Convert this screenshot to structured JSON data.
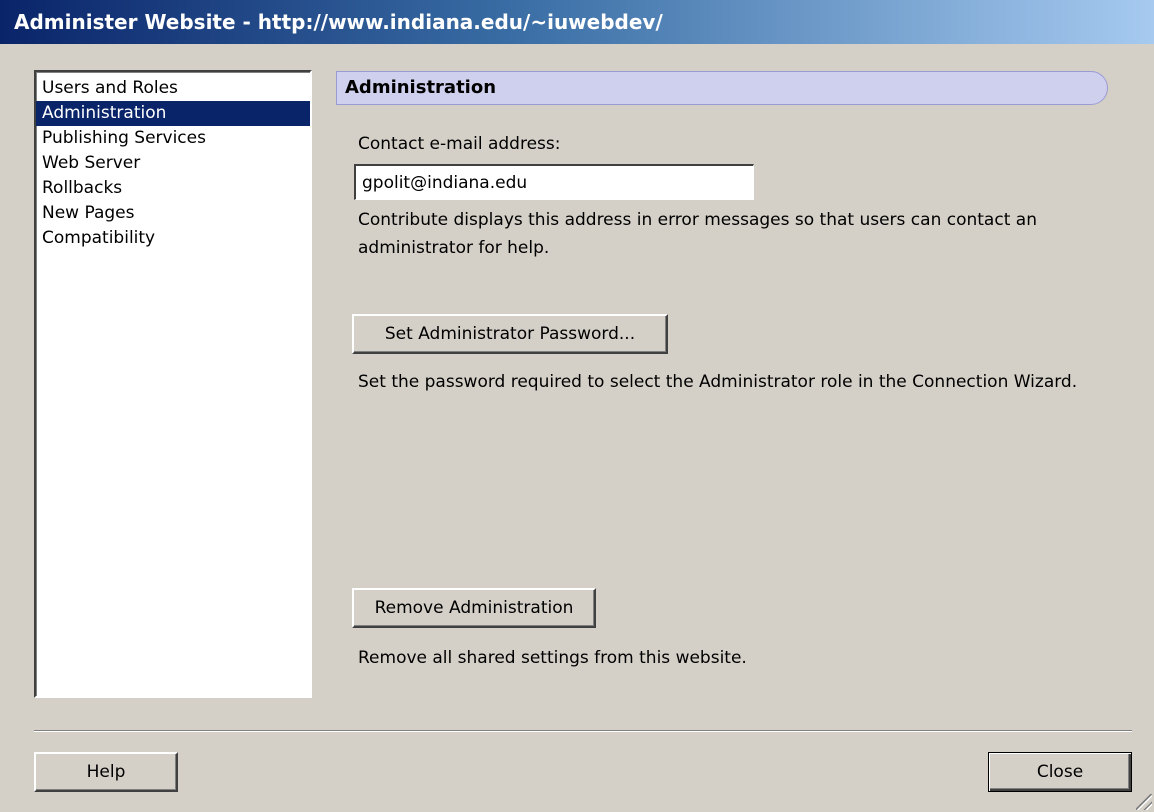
{
  "window": {
    "title": "Administer Website - http://www.indiana.edu/~iuwebdev/"
  },
  "sidebar": {
    "items": [
      {
        "label": "Users and Roles",
        "selected": false
      },
      {
        "label": "Administration",
        "selected": true
      },
      {
        "label": "Publishing Services",
        "selected": false
      },
      {
        "label": "Web Server",
        "selected": false
      },
      {
        "label": "Rollbacks",
        "selected": false
      },
      {
        "label": "New Pages",
        "selected": false
      },
      {
        "label": "Compatibility",
        "selected": false
      }
    ]
  },
  "panel": {
    "header": "Administration",
    "contact_label": "Contact e-mail address:",
    "contact_value": "gpolit@indiana.edu",
    "contact_help": "Contribute displays this address in error messages so that users can contact an administrator for help.",
    "set_password_button": "Set Administrator Password...",
    "set_password_help": "Set the password required to select the Administrator role in the Connection Wizard.",
    "remove_button": "Remove Administration",
    "remove_help": "Remove all shared settings from this website."
  },
  "footer": {
    "help_button": "Help",
    "close_button": "Close"
  },
  "colors": {
    "selection": "#0a246a",
    "header_band": "#cfcfee",
    "dialog_bg": "#d4d0c8"
  },
  "icons": {
    "resize_grip": "size-grip-icon"
  }
}
